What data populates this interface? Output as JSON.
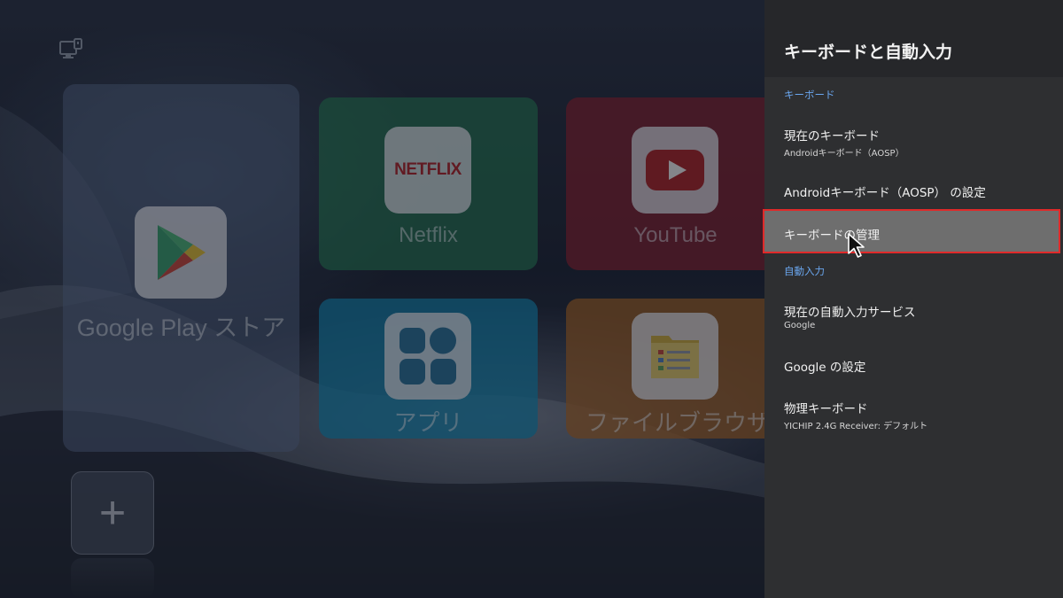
{
  "launcher": {
    "tiles": {
      "play": {
        "label": "Google Play ストア",
        "icon": "google-play-icon"
      },
      "netflix": {
        "label": "Netflix",
        "icon_text": "NETFLIX",
        "icon": "netflix-icon"
      },
      "youtube": {
        "label": "YouTube",
        "icon": "youtube-icon"
      },
      "apps": {
        "label": "アプリ",
        "icon": "apps-grid-icon"
      },
      "files": {
        "label": "ファイルブラウザ",
        "icon": "file-browser-icon"
      }
    },
    "add_symbol": "+"
  },
  "panel": {
    "title": "キーボードと自動入力",
    "keyboard_section": {
      "header": "キーボード",
      "current_keyboard": {
        "title": "現在のキーボード",
        "value": "Androidキーボード（AOSP）"
      },
      "aosp_settings": {
        "title": "Androidキーボード（AOSP） の設定"
      },
      "manage": {
        "title": "キーボードの管理"
      }
    },
    "autofill_section": {
      "header": "自動入力",
      "current_service": {
        "title": "現在の自動入力サービス",
        "value": "Google"
      },
      "google_settings": {
        "title": "Google の設定"
      },
      "physical_keyboard": {
        "title": "物理キーボード",
        "value": "YICHIP 2.4G Receiver: デフォルト"
      }
    }
  },
  "colors": {
    "panel_bg": "#2e2f31",
    "section_header": "#6aa6ee",
    "selected_bg": "#6e6e6e",
    "selected_outline": "#e02a2a"
  }
}
